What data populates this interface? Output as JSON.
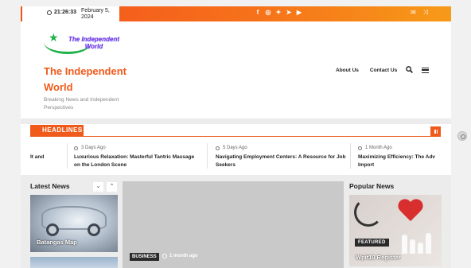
{
  "topbar": {
    "time": "21:26:33",
    "date": "February 5, 2024",
    "social_icons": [
      "facebook-icon",
      "instagram-icon",
      "twitter-icon",
      "telegram-icon",
      "youtube-icon"
    ],
    "right_icons": [
      "mail-icon",
      "shuffle-icon"
    ]
  },
  "header": {
    "logo_text": "The Independent World",
    "site_title": "The Independent World",
    "tagline": "Breaking News and Independent Perspectives",
    "nav": [
      "About Us",
      "Contact Us"
    ]
  },
  "headlines": {
    "label": "HEADLINES",
    "items": [
      {
        "meta": "",
        "title": "It and"
      },
      {
        "meta": "3 Days Ago",
        "title": "Luxurious Relaxation: Masterful Tantric Massage on the London Scene"
      },
      {
        "meta": "5 Days Ago",
        "title": "Navigating Employment Centers: A Resource for Job Seekers"
      },
      {
        "meta": "1 Month Ago",
        "title": "Maximizing Efficiency: The Adv Import"
      }
    ]
  },
  "latest": {
    "title": "Latest News",
    "card_caption": "Batangas Map"
  },
  "main": {
    "category": "BUSINESS",
    "meta": "1 month ago"
  },
  "popular": {
    "title": "Popular News",
    "badge": "FEATURED",
    "card_caption": "Wpit18 Register"
  },
  "colors": {
    "accent": "#f05a1a",
    "logo_green": "#1fb24a"
  }
}
